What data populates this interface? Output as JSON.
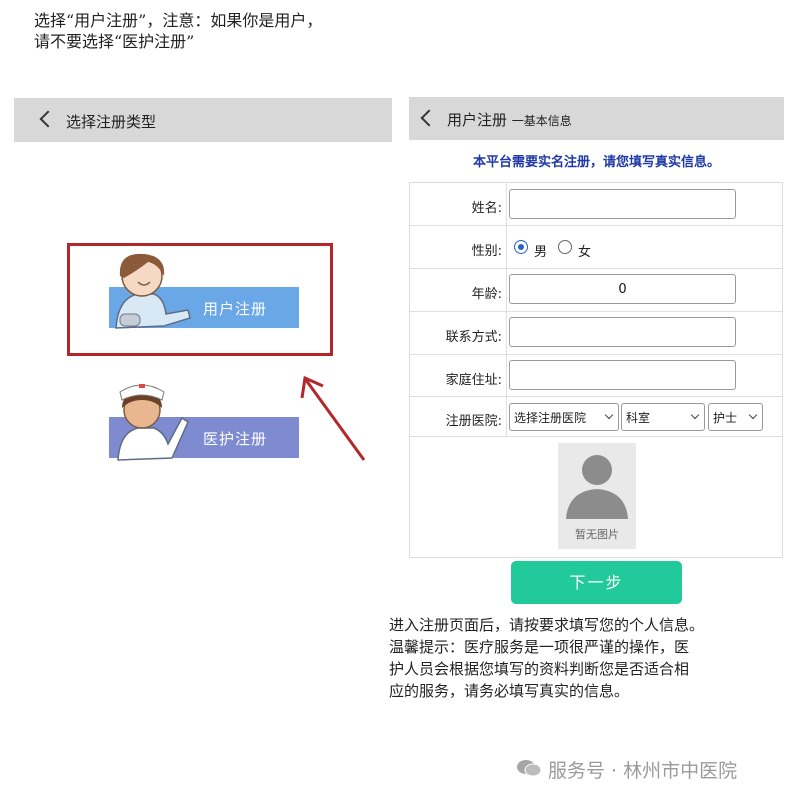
{
  "intro": {
    "line1": "选择“用户注册”，注意：如果你是用户，",
    "line2": "请不要选择“医护注册”"
  },
  "left_panel": {
    "header_title": "选择注册类型",
    "user_register_label": "用户注册",
    "medical_register_label": "医护注册",
    "highlight_color": "#b3272b"
  },
  "right_panel": {
    "header_title": "用户注册",
    "header_subtitle": "一基本信息",
    "realname_notice": "本平台需要实名注册，请您填写真实信息。",
    "form": {
      "name_label": "姓名:",
      "name_value": "",
      "gender_label": "性别:",
      "gender_options": [
        "男",
        "女"
      ],
      "gender_selected": "男",
      "age_label": "年龄:",
      "age_value": "0",
      "contact_label": "联系方式:",
      "contact_value": "",
      "address_label": "家庭住址:",
      "address_value": "",
      "hospital_label": "注册医院:",
      "hospital_select": "选择注册医院",
      "department_select": "科室",
      "role_select": "护士"
    },
    "photo_caption": "暂无图片",
    "next_button": "下一步",
    "accent_color": "#22c99b"
  },
  "bottom_note": {
    "line1": "进入注册页面后，请按要求填写您的个人信息。",
    "line2": "温馨提示：医疗服务是一项很严谨的操作，医",
    "line3": "护人员会根据您填写的资料判断您是否适合相",
    "line4": "应的服务，请务必填写真实的信息。"
  },
  "watermark": {
    "text": "服务号 · 林州市中医院",
    "icon": "wechat-icon"
  }
}
